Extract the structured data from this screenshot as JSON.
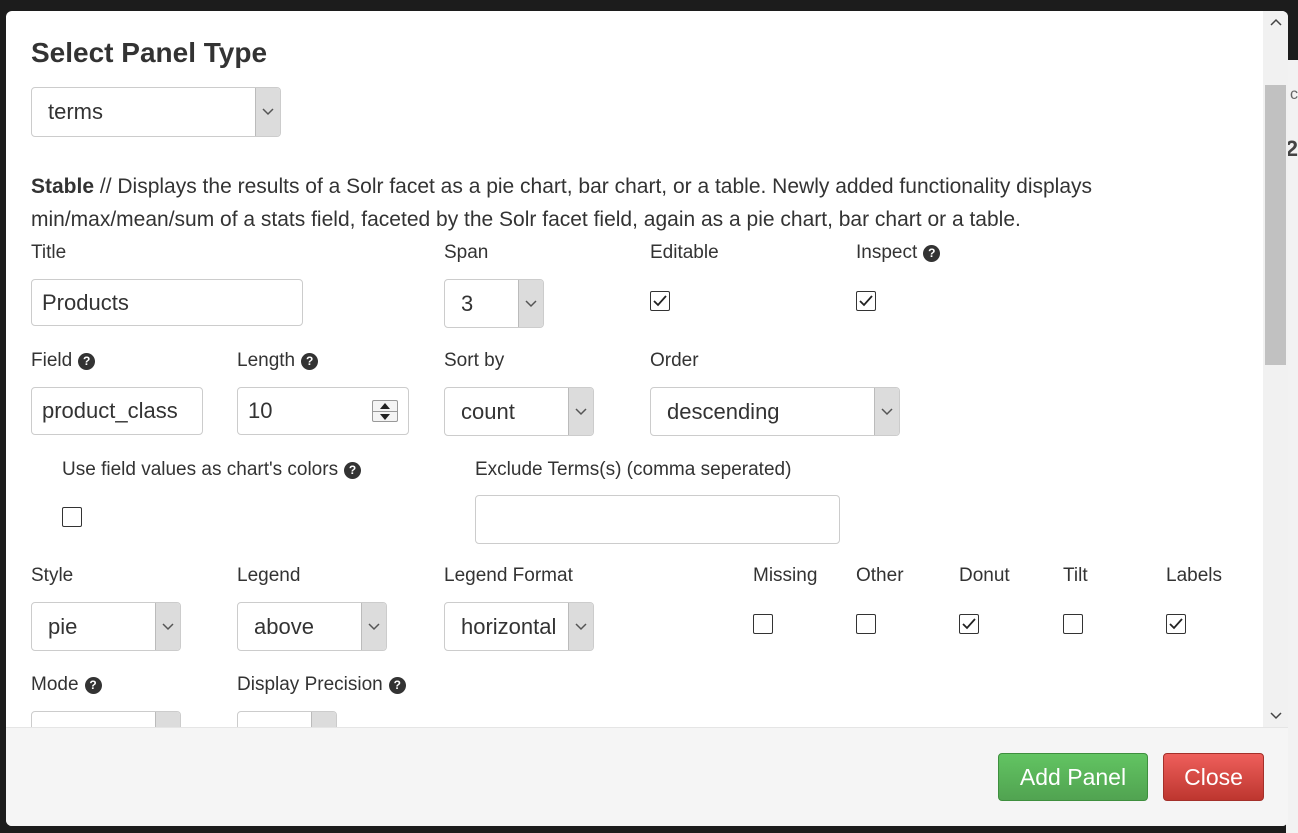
{
  "modal": {
    "title": "Select Panel Type",
    "panel_type": "terms",
    "description": {
      "badge": "Stable",
      "text": " // Displays the results of a Solr facet as a pie chart, bar chart, or a table. Newly added functionality displays min/max/mean/sum of a stats field, faceted by the Solr facet field, again as a pie chart, bar chart or a table."
    }
  },
  "form": {
    "title": {
      "label": "Title",
      "value": "Products"
    },
    "span": {
      "label": "Span",
      "value": "3"
    },
    "editable": {
      "label": "Editable",
      "checked": true
    },
    "inspect": {
      "label": "Inspect",
      "checked": true
    },
    "field": {
      "label": "Field",
      "value": "product_class"
    },
    "length": {
      "label": "Length",
      "value": "10"
    },
    "sort_by": {
      "label": "Sort by",
      "value": "count"
    },
    "order": {
      "label": "Order",
      "value": "descending"
    },
    "use_field_colors": {
      "label": "Use field values as chart's colors",
      "checked": false
    },
    "exclude_terms": {
      "label": "Exclude Terms(s) (comma seperated)",
      "value": ""
    },
    "style": {
      "label": "Style",
      "value": "pie"
    },
    "legend": {
      "label": "Legend",
      "value": "above"
    },
    "legend_format": {
      "label": "Legend Format",
      "value": "horizontal"
    },
    "missing": {
      "label": "Missing",
      "checked": false
    },
    "other": {
      "label": "Other",
      "checked": false
    },
    "donut": {
      "label": "Donut",
      "checked": true
    },
    "tilt": {
      "label": "Tilt",
      "checked": false
    },
    "labels": {
      "label": "Labels",
      "checked": true
    },
    "mode": {
      "label": "Mode",
      "value": ""
    },
    "display_precision": {
      "label": "Display Precision",
      "value": ""
    }
  },
  "footer": {
    "add_panel_label": "Add Panel",
    "close_label": "Close"
  },
  "icons": {
    "help": "question-circle-icon",
    "dropdown": "chevron-down-icon",
    "check": "check-icon"
  },
  "colors": {
    "success": "#51a351",
    "danger": "#bd362f"
  }
}
